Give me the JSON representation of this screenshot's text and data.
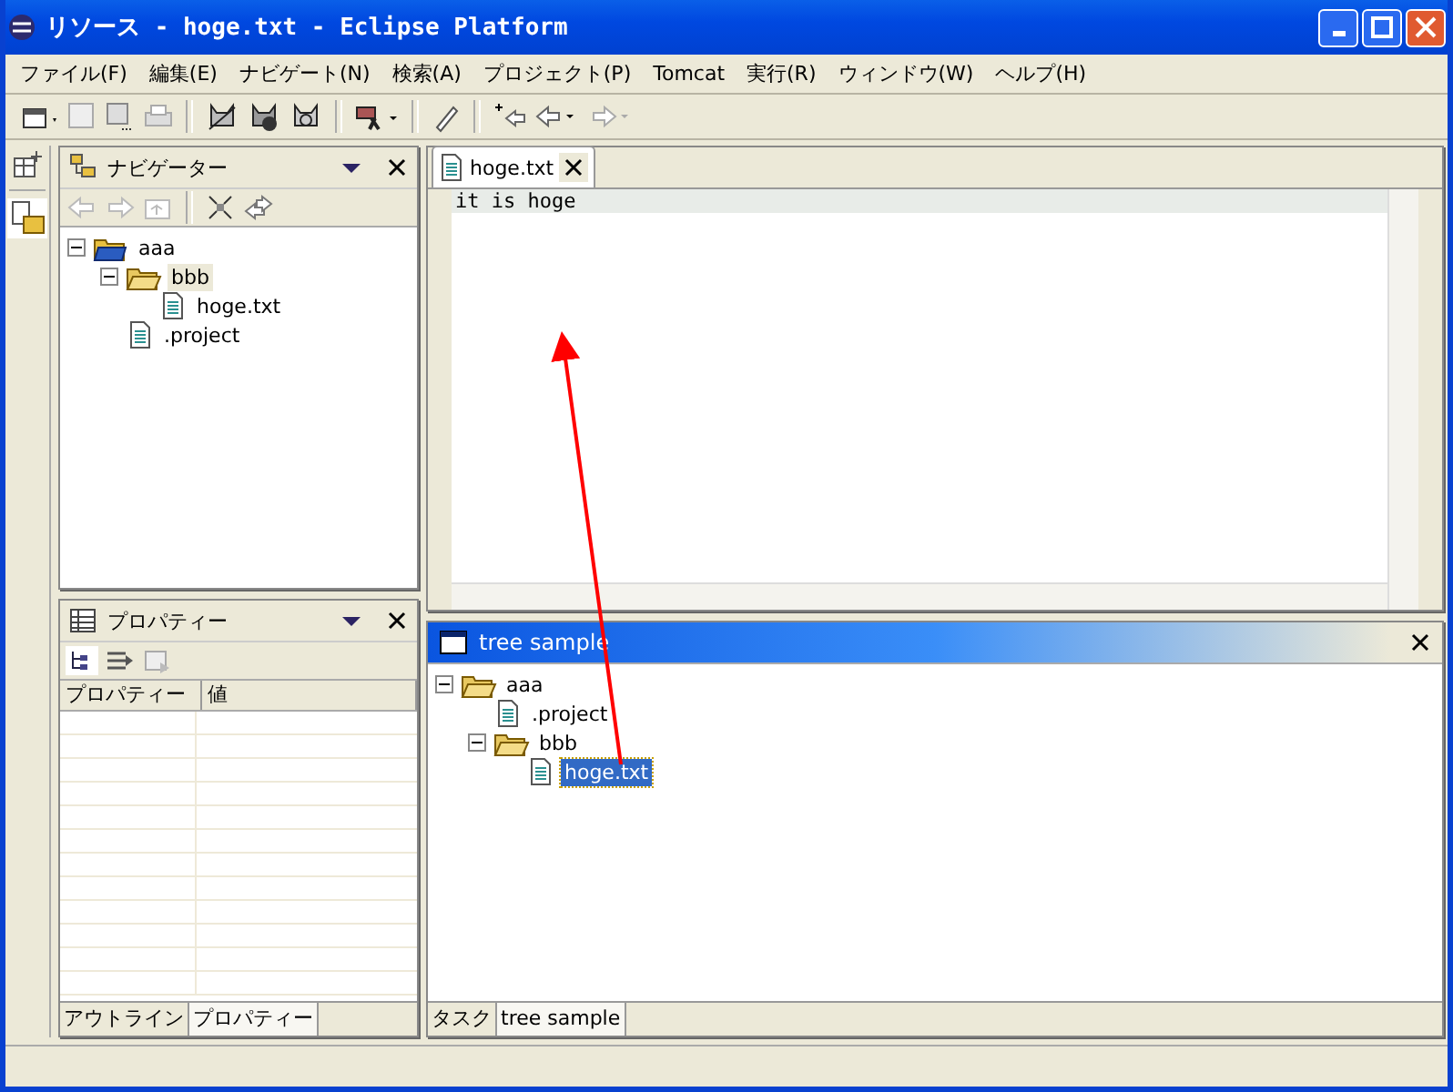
{
  "window": {
    "title": "リソース - hoge.txt - Eclipse Platform"
  },
  "menu": [
    "ファイル(F)",
    "編集(E)",
    "ナビゲート(N)",
    "検索(A)",
    "プロジェクト(P)",
    "Tomcat",
    "実行(R)",
    "ウィンドウ(W)",
    "ヘルプ(H)"
  ],
  "navigator": {
    "title": "ナビゲーター",
    "tree": [
      {
        "label": "aaa",
        "kind": "project",
        "expanded": true,
        "selected": false,
        "children": [
          {
            "label": "bbb",
            "kind": "folder",
            "expanded": true,
            "selected": true,
            "children": [
              {
                "label": "hoge.txt",
                "kind": "file",
                "selected": false
              }
            ]
          },
          {
            "label": ".project",
            "kind": "file",
            "selected": false
          }
        ]
      }
    ]
  },
  "properties": {
    "title": "プロパティー",
    "columns": [
      "プロパティー",
      "値"
    ],
    "tabs": [
      {
        "label": "アウトライン",
        "selected": false
      },
      {
        "label": "プロパティー",
        "selected": true
      }
    ]
  },
  "editor": {
    "tab": "hoge.txt",
    "lines": [
      "it is hoge"
    ]
  },
  "tree_sample": {
    "title": "tree sample",
    "tree": [
      {
        "label": "aaa",
        "kind": "folder",
        "expanded": true,
        "selected": false,
        "children": [
          {
            "label": ".project",
            "kind": "file",
            "selected": false
          },
          {
            "label": "bbb",
            "kind": "folder",
            "expanded": true,
            "selected": false,
            "children": [
              {
                "label": "hoge.txt",
                "kind": "file",
                "selected": true
              }
            ]
          }
        ]
      }
    ],
    "tabs": [
      {
        "label": "タスク",
        "selected": false
      },
      {
        "label": "tree sample",
        "selected": true
      }
    ]
  }
}
